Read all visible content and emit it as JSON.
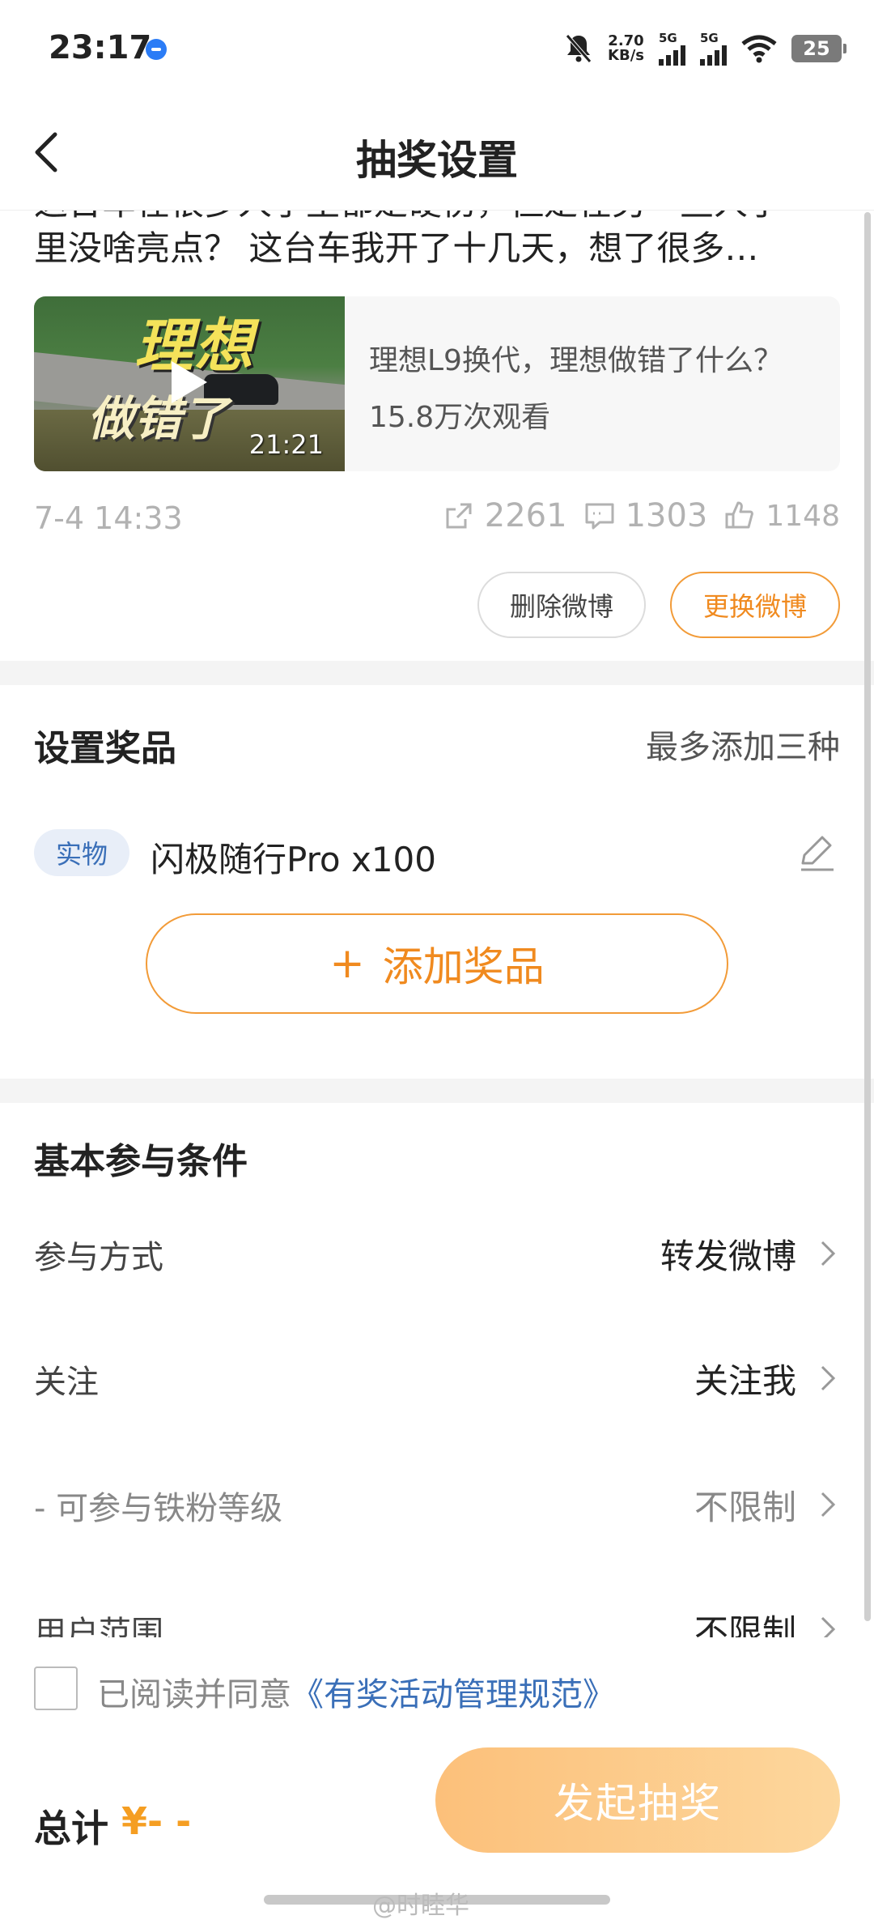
{
  "status_bar": {
    "time": "23:17",
    "net_speed_value": "2.70",
    "net_speed_unit": "KB/s",
    "sim1": "5G",
    "sim2": "5G",
    "battery": "25"
  },
  "nav": {
    "title": "抽奖设置"
  },
  "post": {
    "text_partial_top": "这台车在很多人手里都是硬伤，但是在另一些人手",
    "text_line": "里没啥亮点？ 这台车我开了十几天，想了很多…",
    "video": {
      "thumb_text_1": "理想",
      "thumb_text_2": "做错了",
      "duration": "21:21",
      "title": "理想L9换代，理想做错了什么？",
      "views": "15.8万次观看"
    },
    "date": "7-4 14:33",
    "reposts": "2261",
    "comments": "1303",
    "likes": "1148",
    "delete_label": "删除微博",
    "change_label": "更换微博"
  },
  "prizes": {
    "title": "设置奖品",
    "hint": "最多添加三种",
    "items": [
      {
        "tag": "实物",
        "name": "闪极随行Pro x100"
      }
    ],
    "add_label": "添加奖品",
    "add_plus": "+"
  },
  "conditions": {
    "title": "基本参与条件",
    "rows": [
      {
        "label": "参与方式",
        "value": "转发微博"
      },
      {
        "label": "关注",
        "value": "关注我"
      },
      {
        "label": "- 可参与铁粉等级",
        "value": "不限制"
      },
      {
        "label": "用户范围",
        "value": "不限制"
      }
    ]
  },
  "agreement": {
    "prefix": "已阅读并同意",
    "link": "《有奖活动管理规范》",
    "checked": false
  },
  "footer": {
    "total_label": "总计",
    "total_value": "¥- -",
    "launch_label": "发起抽奖",
    "watermark": "@时睦华"
  },
  "colors": {
    "accent": "#f08a1f",
    "link": "#3a6fb8",
    "launch_gradient_start": "#fcc07a",
    "launch_gradient_end": "#fdd79d"
  }
}
